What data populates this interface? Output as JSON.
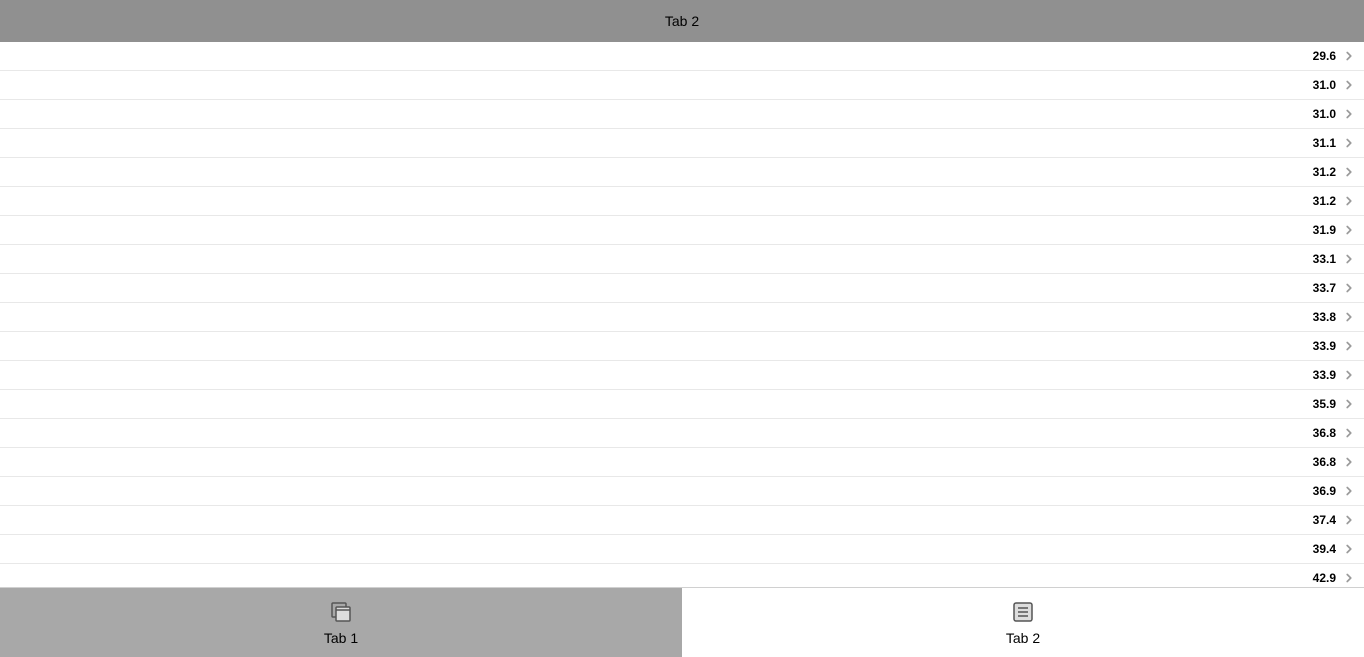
{
  "header": {
    "title": "Tab 2"
  },
  "list": {
    "items": [
      {
        "value": "29.6"
      },
      {
        "value": "31.0"
      },
      {
        "value": "31.0"
      },
      {
        "value": "31.1"
      },
      {
        "value": "31.2"
      },
      {
        "value": "31.2"
      },
      {
        "value": "31.9"
      },
      {
        "value": "33.1"
      },
      {
        "value": "33.7"
      },
      {
        "value": "33.8"
      },
      {
        "value": "33.9"
      },
      {
        "value": "33.9"
      },
      {
        "value": "35.9"
      },
      {
        "value": "36.8"
      },
      {
        "value": "36.8"
      },
      {
        "value": "36.9"
      },
      {
        "value": "37.4"
      },
      {
        "value": "39.4"
      },
      {
        "value": "42.9"
      }
    ]
  },
  "tabs": [
    {
      "label": "Tab 1",
      "icon": "windows-icon",
      "active": true
    },
    {
      "label": "Tab 2",
      "icon": "list-icon",
      "active": false
    }
  ]
}
